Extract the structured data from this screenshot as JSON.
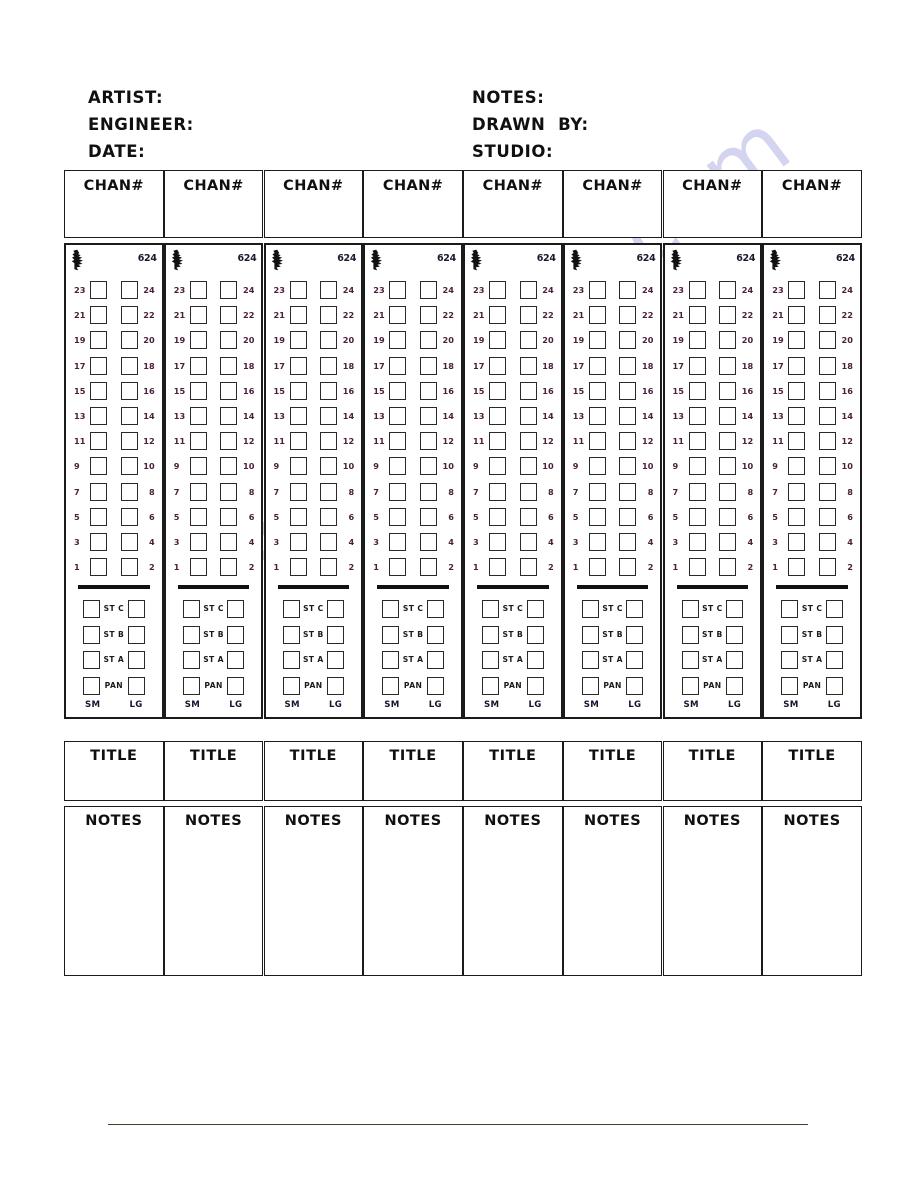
{
  "header": {
    "left_fields": [
      "ARTIST:",
      "ENGINEER:",
      "DATE:"
    ],
    "right_fields": [
      "NOTES:",
      "DRAWN  BY:",
      "STUDIO:"
    ]
  },
  "strip": {
    "channel_header_label": "CHAN#",
    "logo_icon": "api-bird-logo-icon",
    "model_number": "624",
    "number_rows": [
      {
        "left": "23",
        "right": "24"
      },
      {
        "left": "21",
        "right": "22"
      },
      {
        "left": "19",
        "right": "20"
      },
      {
        "left": "17",
        "right": "18"
      },
      {
        "left": "15",
        "right": "16"
      },
      {
        "left": "13",
        "right": "14"
      },
      {
        "left": "11",
        "right": "12"
      },
      {
        "left": "9",
        "right": "10"
      },
      {
        "left": "7",
        "right": "8"
      },
      {
        "left": "5",
        "right": "6"
      },
      {
        "left": "3",
        "right": "4"
      },
      {
        "left": "1",
        "right": "2"
      }
    ],
    "st_rows": [
      "ST C",
      "ST B",
      "ST A",
      "PAN"
    ],
    "size_labels": {
      "small": "SM",
      "large": "LG"
    },
    "title_label": "TITLE",
    "notes_label": "NOTES"
  },
  "channel_count": 8,
  "watermark": {
    "text": "manualshive.com"
  },
  "colors": {
    "ink": "#101010",
    "box_border": "#2a2a2a",
    "number_text": "#4a1f3a",
    "watermark": "#b9bbe6",
    "footer_rule": "#3e4228"
  }
}
